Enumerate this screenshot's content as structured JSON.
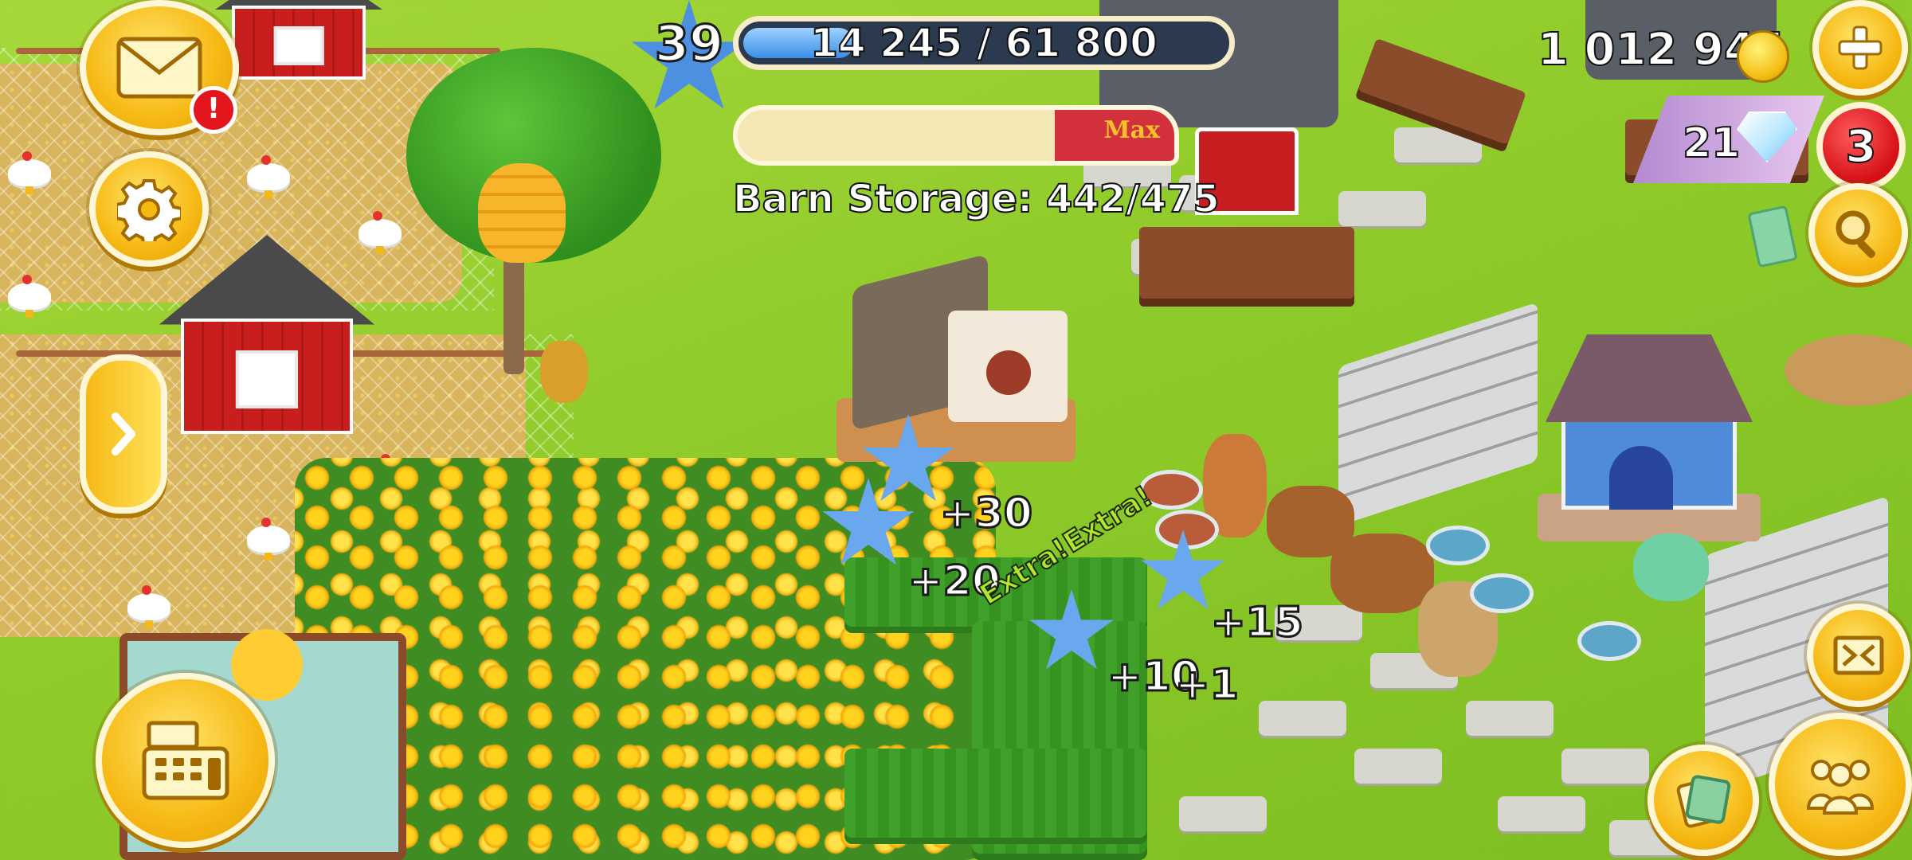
{
  "hud": {
    "level": "39",
    "xp": {
      "current": 14245,
      "max": 61800,
      "text": "14 245 / 61 800"
    },
    "barn_storage": {
      "label": "Barn Storage: 442/475",
      "max_label": "Max",
      "fill_fraction": 0.93
    },
    "coins": "1 012 944",
    "diamonds": "21",
    "notifications_count": "3",
    "mail_alert": "!"
  },
  "buttons": {
    "mail": "mail-icon",
    "settings": "gear-icon",
    "expand_side": "chevron-right-icon",
    "shop": "cash-register-icon",
    "add_currency": "plus-icon",
    "search": "magnifier-icon",
    "fullscreen": "expand-arrows-icon",
    "friends": "people-icon",
    "cards": "card-pack-icon"
  },
  "rewards": {
    "floating": [
      "+30",
      "+20",
      "+15",
      "+10",
      "+1"
    ],
    "extra_banner": "Extra!Extra!"
  },
  "colors": {
    "grass": "#8fcb2a",
    "hud_gold": "#f6b914",
    "xp_blue": "#3b8de6",
    "alert_red": "#d40f16",
    "barn_max_red": "#d2303d"
  }
}
